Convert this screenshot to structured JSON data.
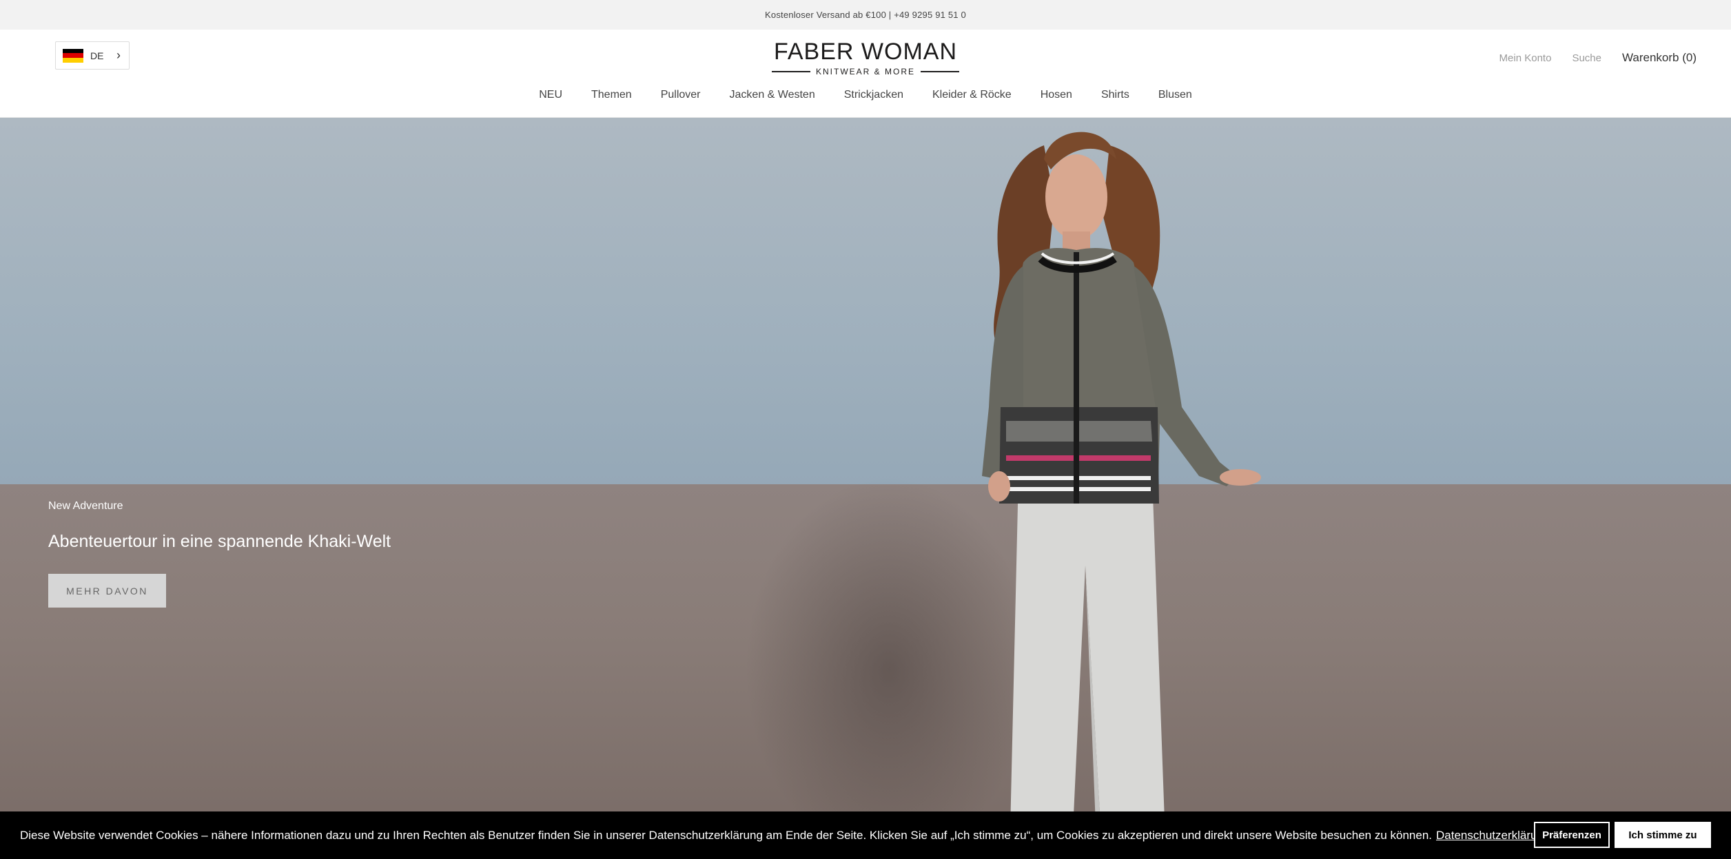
{
  "announcement": {
    "text": "Kostenloser Versand ab €100 | +49 9295 91 51 0"
  },
  "header": {
    "language": {
      "code": "DE",
      "flag_colors": [
        "#000000",
        "#dd0000",
        "#ffce00"
      ]
    },
    "logo": {
      "title": "FABER WOMAN",
      "subtitle": "KNITWEAR & MORE"
    },
    "links": {
      "account": "Mein Konto",
      "search": "Suche",
      "cart": "Warenkorb (0)"
    }
  },
  "nav": {
    "items": [
      {
        "label": "NEU"
      },
      {
        "label": "Themen"
      },
      {
        "label": "Pullover"
      },
      {
        "label": "Jacken & Westen"
      },
      {
        "label": "Strickjacken"
      },
      {
        "label": "Kleider & Röcke"
      },
      {
        "label": "Hosen"
      },
      {
        "label": "Shirts"
      },
      {
        "label": "Blusen"
      }
    ]
  },
  "hero": {
    "kicker": "New Adventure",
    "heading": "Abenteuertour in eine spannende Khaki-Welt",
    "button": "MEHR DAVON"
  },
  "cookie": {
    "text": "Diese Website verwendet Cookies – nähere Informationen dazu und zu Ihren Rechten als Benutzer finden Sie in unserer Datenschutzerklärung am Ende der Seite. Klicken Sie auf „Ich stimme zu“, um Cookies zu akzeptieren und direkt unsere Website besuchen zu können.",
    "link": "Datenschutzerklärung",
    "preferences": "Präferenzen",
    "accept": "Ich stimme zu"
  }
}
